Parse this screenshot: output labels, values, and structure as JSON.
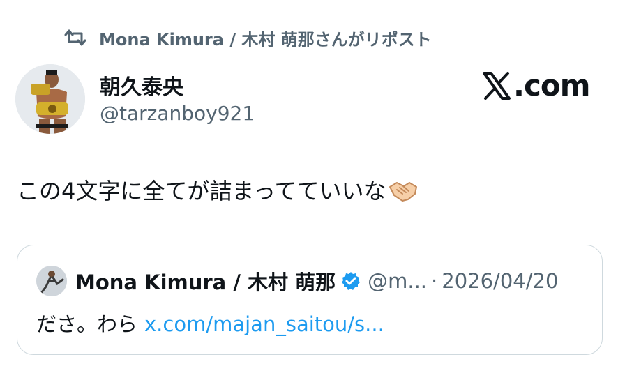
{
  "repost": {
    "icon": "repost-icon",
    "text": "Mona Kimura / 木村 萌那さんがリポスト"
  },
  "author": {
    "name": "朝久泰央",
    "handle": "@tarzanboy921",
    "avatar": "avatar"
  },
  "brand": {
    "label": ".com",
    "icon": "x-logo-icon"
  },
  "tweet": {
    "text": "この4文字に全てが詰まってていいな",
    "emoji": "handshake-icon"
  },
  "quote": {
    "name": "Mona Kimura / 木村 萌那",
    "handle": "@m...",
    "separator": "·",
    "date": "2026/04/20",
    "text": "ださ。わら",
    "link": "x.com/majan_saitou/s...",
    "verified_icon": "verified-badge-icon"
  },
  "colors": {
    "text": "#0f1419",
    "secondary": "#536471",
    "link": "#1d9bf0",
    "border": "#cfd9de"
  }
}
